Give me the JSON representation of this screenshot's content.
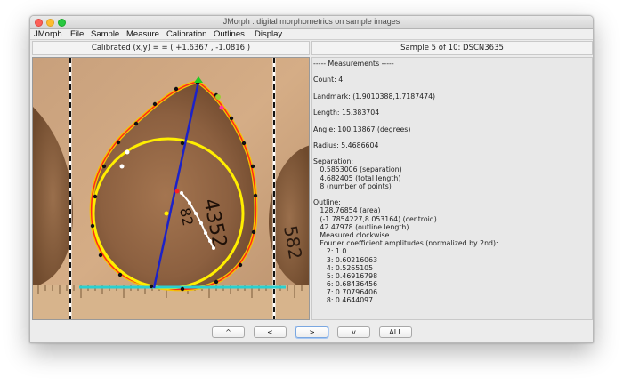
{
  "window": {
    "title": "JMorph : digital morphometrics on sample images"
  },
  "menu": {
    "items": [
      "JMorph",
      "File",
      "Sample",
      "Measure",
      "Calibration",
      "Outlines",
      "Display"
    ]
  },
  "status": {
    "calibrated_label": "Calibrated (x,y) = = (    +1.6367 ,    -1.0816 )",
    "sample_label": "Sample 5 of 10: DSCN3635"
  },
  "measurements": {
    "lines": [
      "----- Measurements -----",
      "",
      "Count: 4",
      "",
      "Landmark: (1.9010388,1.7187474)",
      "",
      "Length: 15.383704",
      "",
      "Angle: 100.13867 (degrees)",
      "",
      "Radius: 5.4686604",
      "",
      "Separation:",
      "   0.5853006 (separation)",
      "   4.682405 (total length)",
      "   8 (number of points)",
      "",
      "Outline:",
      "   128.76854 (area)",
      "   (-1.7854227,8.053164) (centroid)",
      "   42.47978 (outline length)",
      "   Measured clockwise",
      "   Fourier coefficient amplitudes (normalized by 2nd):",
      "      2: 1.0",
      "      3: 0.60216063",
      "      4: 0.5265105",
      "      5: 0.46916798",
      "      6: 0.68436456",
      "      7: 0.70796406",
      "      8: 0.4644097"
    ]
  },
  "buttons": {
    "up": "^",
    "prev": "<",
    "next": ">",
    "down": "v",
    "all": "ALL"
  },
  "colors": {
    "outline": "#ff2a1a",
    "outline_smooth": "#f5c400",
    "fitted_circle": "#ffee00",
    "length_line": "#1c22c8",
    "baseline": "#2ad0d0",
    "separation_points": "#ffffff",
    "landmark": "#22cc22"
  }
}
